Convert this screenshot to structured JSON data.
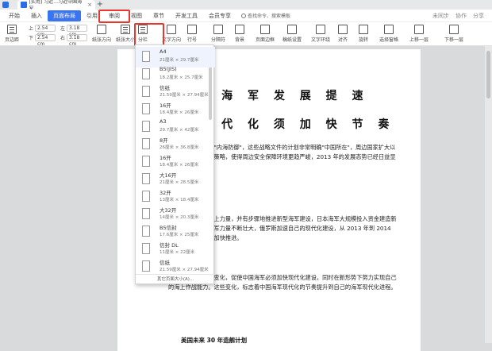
{
  "tabbar": {
    "doc_tab_title": "[实用] 习近…习近中国海军…",
    "close_glyph": "×",
    "newtab_glyph": "+"
  },
  "menubar": {
    "items": [
      "开始",
      "插入",
      "页面布局",
      "引用",
      "审阅",
      "视图",
      "章节",
      "开发工具",
      "会员专享"
    ],
    "active_index": 2,
    "search_placeholder": "查找命令、搜索模板",
    "right_items": [
      "未同步",
      "协作",
      "分享"
    ]
  },
  "toolbar": {
    "margins_label": "页边距",
    "top_label": "上",
    "top_value": "2.54 cm",
    "bottom_label": "下",
    "bottom_value": "2.54 cm",
    "left_label": "左",
    "left_value": "3.18 cm",
    "right_label": "右",
    "right_value": "3.18 cm",
    "orientation_label": "纸张方向",
    "size_label": "纸张大小",
    "columns_label": "分栏",
    "text_direction_label": "文字方向",
    "line_numbers_label": "行号",
    "breaks_label": "分隔符",
    "background_label": "背景",
    "page_border_label": "页面边框",
    "manuscript_label": "稿纸设置",
    "text_wrap_label": "文字环绕",
    "align_label": "对齐",
    "rotate_label": "旋转",
    "selection_pane_label": "选择窗格",
    "up_label": "上移一层",
    "down_label": "下移一层"
  },
  "paper_sizes": {
    "items": [
      {
        "name": "A4",
        "dims": "21厘米 × 29.7厘米"
      },
      {
        "name": "B5(JIS)",
        "dims": "18.2厘米 × 25.7厘米"
      },
      {
        "name": "信纸",
        "dims": "21.59厘米 × 27.94厘米"
      },
      {
        "name": "16开",
        "dims": "18.4厘米 × 26厘米"
      },
      {
        "name": "A3",
        "dims": "29.7厘米 × 42厘米"
      },
      {
        "name": "8开",
        "dims": "26厘米 × 36.8厘米"
      },
      {
        "name": "16开",
        "dims": "18.4厘米 × 26厘米"
      },
      {
        "name": "大16开",
        "dims": "21厘米 × 28.5厘米"
      },
      {
        "name": "32开",
        "dims": "13厘米 × 18.4厘米"
      },
      {
        "name": "大32开",
        "dims": "14厘米 × 20.3厘米"
      },
      {
        "name": "B5信封",
        "dims": "17.6厘米 × 25厘米"
      },
      {
        "name": "信封 DL",
        "dims": "11厘米 × 22厘米"
      },
      {
        "name": "信纸",
        "dims": "21.59厘米 × 27.94厘米"
      }
    ],
    "footer": "其它页面大小(A)..."
  },
  "document": {
    "title_line1": "世 界 海 军 发 展 提 速",
    "title_line2": "海 军 现 代 化 须 加 快 节 奏",
    "para1": "美国的建议中点是\"内海防御\"，这些战略文件的计划非常明确\"中国所在\"，周边国家扩大以及制定海上的基本策略，使得周边安全保障环境更趋严峻，2013 年的发展态势已经日益显现。",
    "para2": "日本加强自己的海上力量，并有步骤地推进新型海军建设，日本海军大规模投入资金建造新型舰艇，韩国的海军力量不断壮大，俄罗斯加速自己的现代化建设，从 2013 年到 2014 年，这些国家都在加快推进。",
    "para3": "各国海军的发展和变化，促使中国海军必须加快现代化建设，同时在新形势下努力实现自己的海上作战能力。这些变化，标志着中国海军现代化的节奏提升到自己的海军现代化进程。",
    "sub_heading": "美国未来 30 年造舰计划"
  }
}
